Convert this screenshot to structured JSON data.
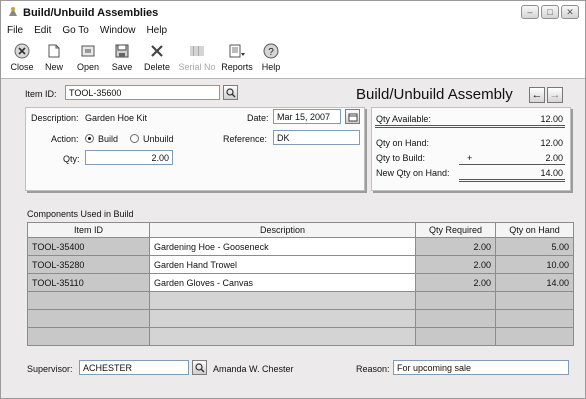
{
  "window": {
    "title": "Build/Unbuild Assemblies",
    "controls": [
      "–",
      "□",
      "✕"
    ]
  },
  "menu": [
    "File",
    "Edit",
    "Go To",
    "Window",
    "Help"
  ],
  "toolbar": {
    "close": "Close",
    "new": "New",
    "open": "Open",
    "save": "Save",
    "delete": "Delete",
    "serial_no": "Serial No",
    "reports": "Reports",
    "help": "Help"
  },
  "form": {
    "item_id_label": "Item ID:",
    "item_id_value": "TOOL-35600",
    "heading": "Build/Unbuild Assembly",
    "description_label": "Description:",
    "description_value": "Garden Hoe Kit",
    "date_label": "Date:",
    "date_value": "Mar 15, 2007",
    "action_label": "Action:",
    "action_build": "Build",
    "action_unbuild": "Unbuild",
    "action_selected": "Build",
    "reference_label": "Reference:",
    "reference_value": "DK",
    "qty_label": "Qty:",
    "qty_value": "2.00"
  },
  "summary": {
    "qty_available_label": "Qty Available:",
    "qty_available_value": "12.00",
    "qty_on_hand_label": "Qty on Hand:",
    "qty_on_hand_value": "12.00",
    "qty_to_build_label": "Qty to Build:",
    "qty_to_build_sign": "+",
    "qty_to_build_value": "2.00",
    "new_qty_label": "New Qty on Hand:",
    "new_qty_value": "14.00"
  },
  "components": {
    "section_label": "Components Used in Build",
    "columns": [
      "Item ID",
      "Description",
      "Qty Required",
      "Qty on Hand"
    ],
    "rows": [
      {
        "item_id": "TOOL-35400",
        "description": "Gardening Hoe - Gooseneck",
        "qty_required": "2.00",
        "qty_on_hand": "5.00"
      },
      {
        "item_id": "TOOL-35280",
        "description": "Garden Hand Trowel",
        "qty_required": "2.00",
        "qty_on_hand": "10.00"
      },
      {
        "item_id": "TOOL-35110",
        "description": "Garden Gloves - Canvas",
        "qty_required": "2.00",
        "qty_on_hand": "14.00"
      }
    ]
  },
  "footer": {
    "supervisor_label": "Supervisor:",
    "supervisor_value": "ACHESTER",
    "supervisor_name": "Amanda W. Chester",
    "reason_label": "Reason:",
    "reason_value": "For upcoming sale"
  }
}
